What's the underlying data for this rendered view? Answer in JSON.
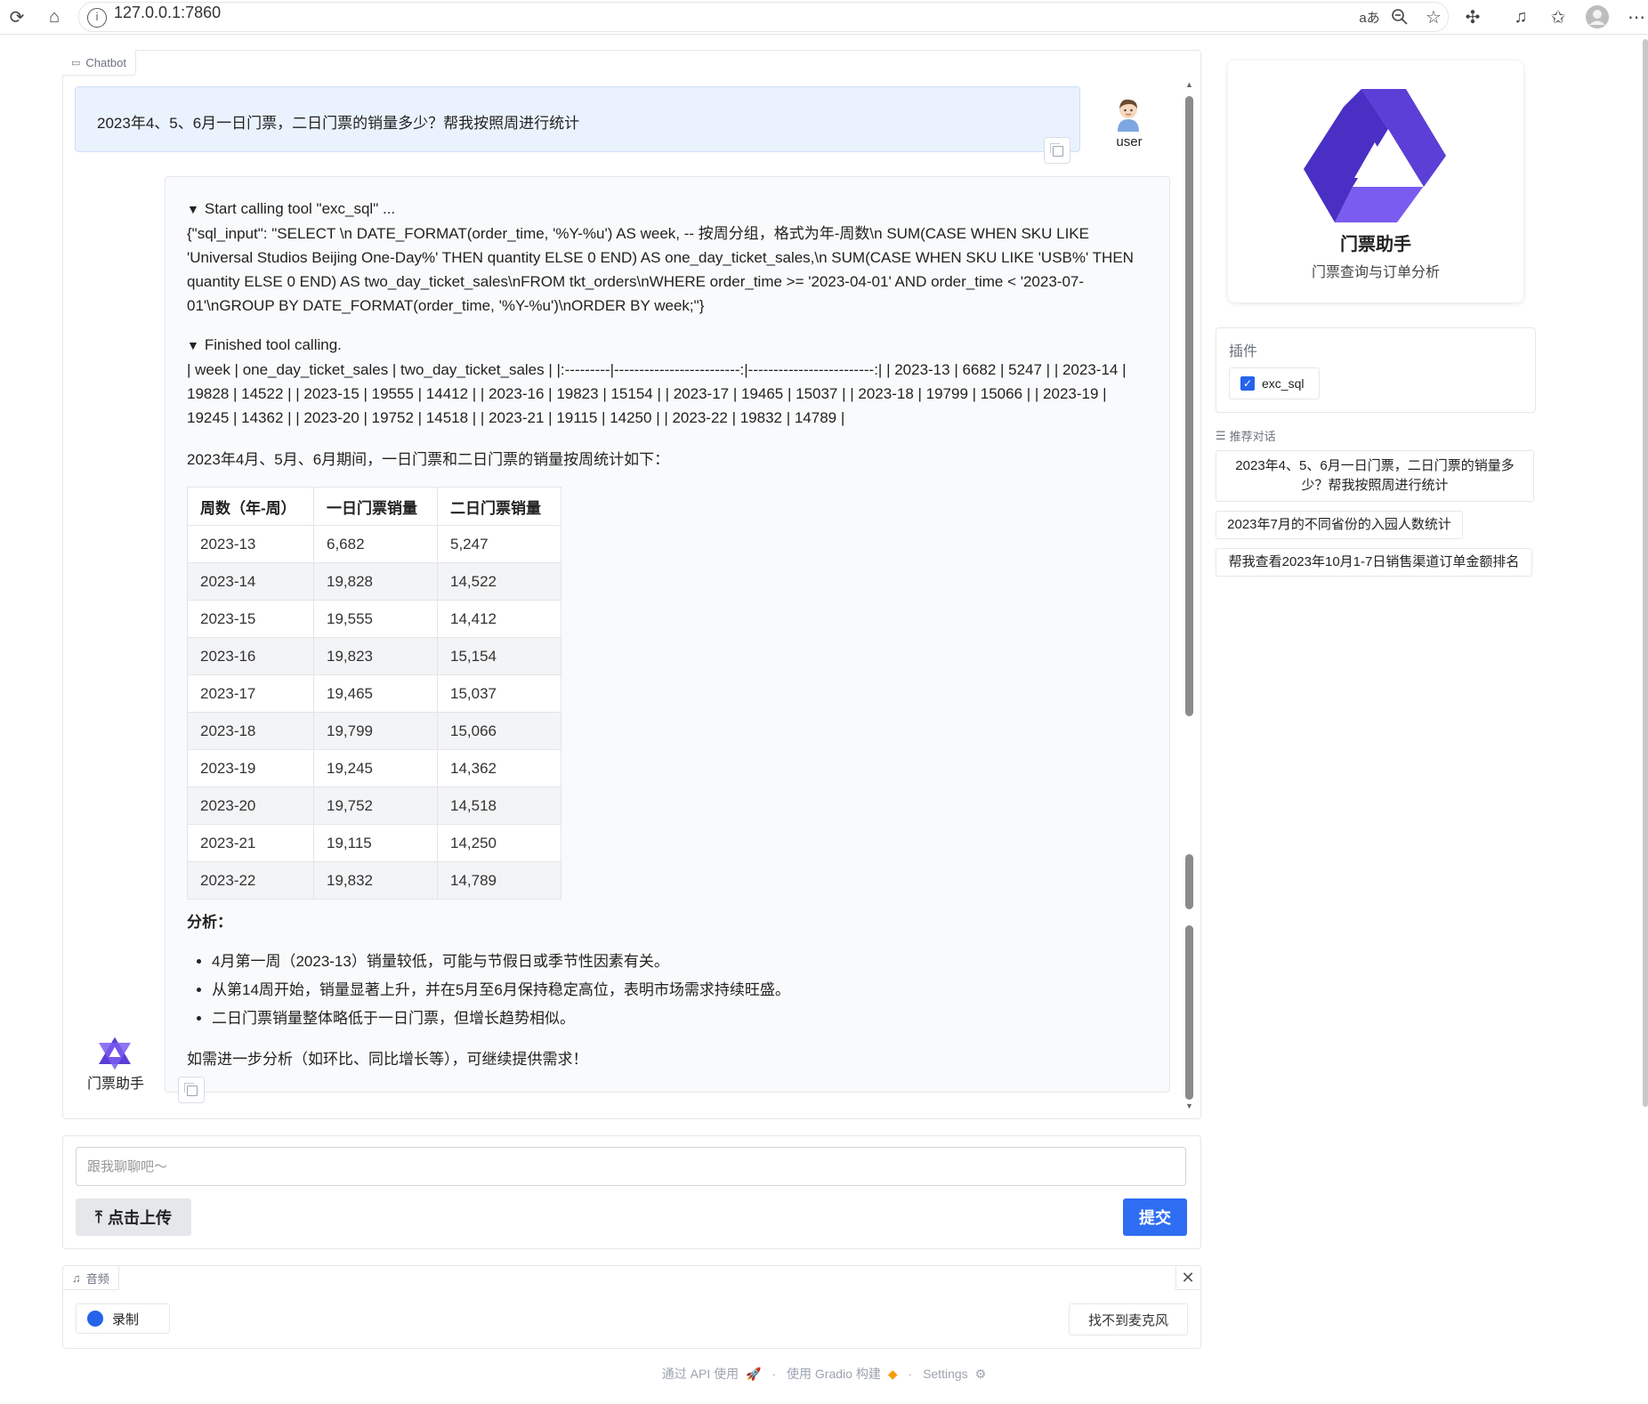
{
  "browser": {
    "url": "127.0.0.1:7860",
    "info_glyph": "i",
    "translate_glyph": "aあ"
  },
  "chatbot": {
    "tag_label": "Chatbot",
    "user_message": "2023年4、5、6月一日门票，二日门票的销量多少？帮我按照周进行统计",
    "user_label": "user",
    "bot_label": "门票助手",
    "tool_call": {
      "header": "Start calling tool \"exc_sql\" ...",
      "body": "{\"sql_input\": \"SELECT \\n DATE_FORMAT(order_time, '%Y-%u') AS week, -- 按周分组，格式为年-周数\\n SUM(CASE WHEN SKU LIKE 'Universal Studios Beijing One-Day%' THEN quantity ELSE 0 END) AS one_day_ticket_sales,\\n SUM(CASE WHEN SKU LIKE 'USB%' THEN quantity ELSE 0 END) AS two_day_ticket_sales\\nFROM tkt_orders\\nWHERE order_time >= '2023-04-01' AND order_time < '2023-07-01'\\nGROUP BY DATE_FORMAT(order_time, '%Y-%u')\\nORDER BY week;\"}"
    },
    "tool_result": {
      "header": "Finished tool calling.",
      "body": "| week | one_day_ticket_sales | two_day_ticket_sales | |:---------|-------------------------:|-------------------------:| | 2023-13 | 6682 | 5247 | | 2023-14 | 19828 | 14522 | | 2023-15 | 19555 | 14412 | | 2023-16 | 19823 | 15154 | | 2023-17 | 19465 | 15037 | | 2023-18 | 19799 | 15066 | | 2023-19 | 19245 | 14362 | | 2023-20 | 19752 | 14518 | | 2023-21 | 19115 | 14250 | | 2023-22 | 19832 | 14789 |"
    },
    "intro": "2023年4月、5月、6月期间，一日门票和二日门票的销量按周统计如下：",
    "table": {
      "headers": [
        "周数（年-周）",
        "一日门票销量",
        "二日门票销量"
      ],
      "rows": [
        [
          "2023-13",
          "6,682",
          "5,247"
        ],
        [
          "2023-14",
          "19,828",
          "14,522"
        ],
        [
          "2023-15",
          "19,555",
          "14,412"
        ],
        [
          "2023-16",
          "19,823",
          "15,154"
        ],
        [
          "2023-17",
          "19,465",
          "15,037"
        ],
        [
          "2023-18",
          "19,799",
          "15,066"
        ],
        [
          "2023-19",
          "19,245",
          "14,362"
        ],
        [
          "2023-20",
          "19,752",
          "14,518"
        ],
        [
          "2023-21",
          "19,115",
          "14,250"
        ],
        [
          "2023-22",
          "19,832",
          "14,789"
        ]
      ]
    },
    "analysis_title": "分析：",
    "analysis_points": [
      "4月第一周（2023-13）销量较低，可能与节假日或季节性因素有关。",
      "从第14周开始，销量显著上升，并在5月至6月保持稳定高位，表明市场需求持续旺盛。",
      "二日门票销量整体略低于一日门票，但增长趋势相似。"
    ],
    "closing": "如需进一步分析（如环比、同比增长等），可继续提供需求！"
  },
  "input": {
    "placeholder": "跟我聊聊吧～",
    "upload_label": "点击上传",
    "submit_label": "提交"
  },
  "audio": {
    "tag_label": "音频",
    "record_label": "录制",
    "mic_label": "找不到麦克风"
  },
  "footer": {
    "api": "通过 API 使用",
    "built": "使用 Gradio 构建",
    "settings": "Settings"
  },
  "sidebar": {
    "brand_name": "门票助手",
    "brand_subtitle": "门票查询与订单分析",
    "plugins_title": "插件",
    "plugin_name": "exc_sql",
    "suggest_title": "推荐对话",
    "suggestions": [
      "2023年4、5、6月一日门票，二日门票的销量多少？帮我按照周进行统计",
      "2023年7月的不同省份的入园人数统计",
      "帮我查看2023年10月1-7日销售渠道订单金额排名"
    ]
  },
  "colors": {
    "accent": "#2f6ef2",
    "user_bubble": "#eaf2fd",
    "logo_purple": "#5b3fd6"
  }
}
